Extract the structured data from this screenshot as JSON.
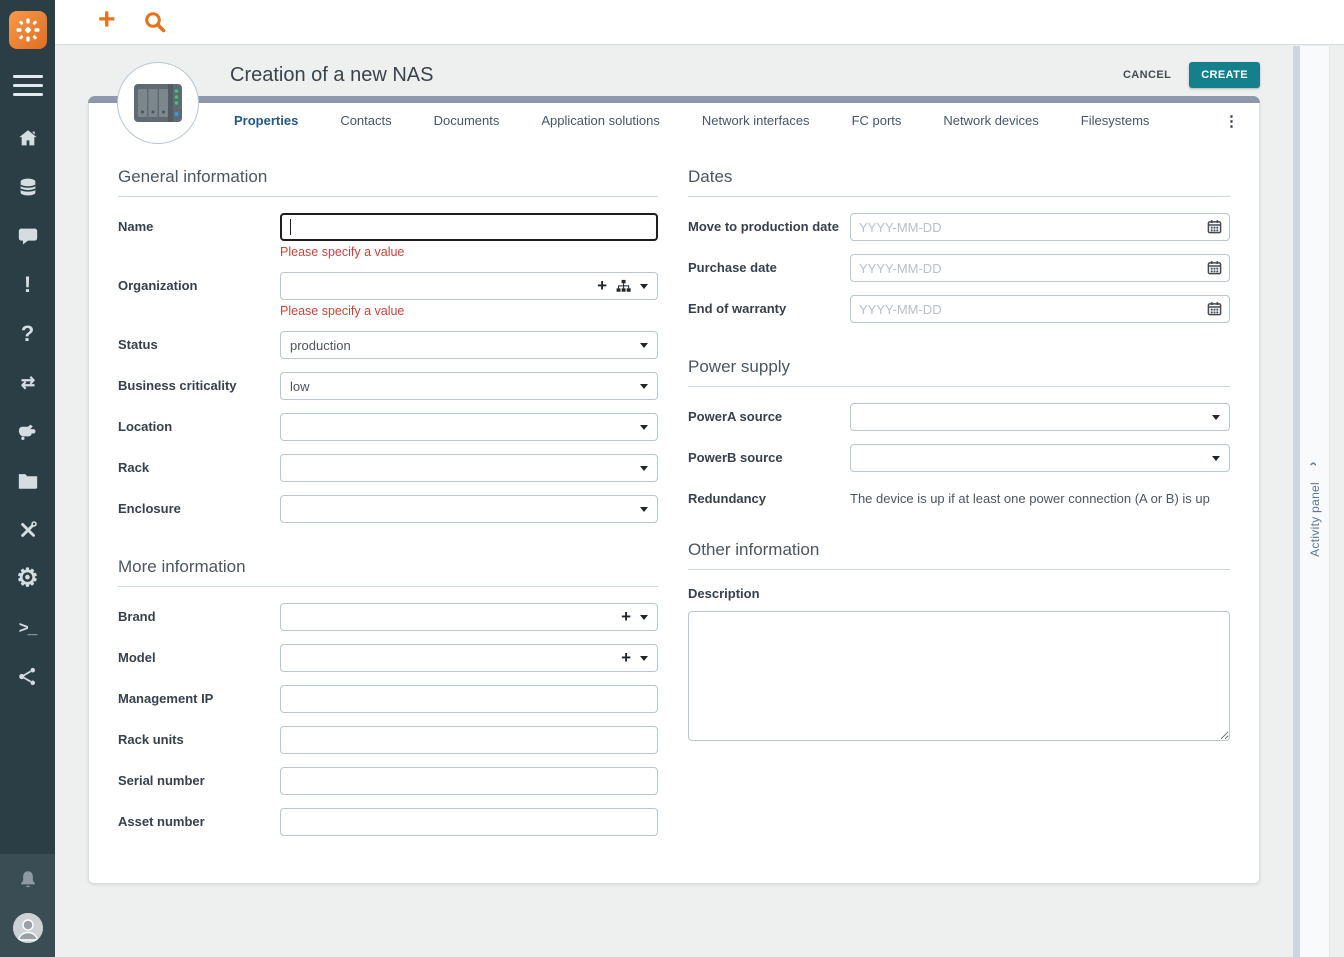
{
  "topbar": {
    "new_label": "+"
  },
  "sidebar": {
    "icons": [
      "itop-logo",
      "menu",
      "home",
      "database",
      "comment",
      "exclamation",
      "question",
      "transfer",
      "handshake",
      "folder",
      "tools",
      "gear",
      "terminal",
      "share"
    ],
    "footer_icons": [
      "bell",
      "user-avatar"
    ],
    "exclamation_glyph": "!",
    "question_glyph": "?",
    "transfer_glyph": "⇄",
    "gear_glyph": "⚙",
    "terminal_glyph": ">_"
  },
  "header": {
    "title": "Creation of a new NAS",
    "cancel": "CANCEL",
    "create": "CREATE"
  },
  "tabs": {
    "active": "Properties",
    "items": [
      "Properties",
      "Contacts",
      "Documents",
      "Application solutions",
      "Network interfaces",
      "FC ports",
      "Network devices",
      "Filesystems"
    ],
    "kebab_glyph": "⋮"
  },
  "form": {
    "general": {
      "title": "General information",
      "name": {
        "label": "Name",
        "value": "",
        "error": "Please specify a value"
      },
      "organization": {
        "label": "Organization",
        "value": "",
        "error": "Please specify a value"
      },
      "status": {
        "label": "Status",
        "value": "production"
      },
      "criticality": {
        "label": "Business criticality",
        "value": "low"
      },
      "location": {
        "label": "Location",
        "value": ""
      },
      "rack": {
        "label": "Rack",
        "value": ""
      },
      "enclosure": {
        "label": "Enclosure",
        "value": ""
      }
    },
    "more": {
      "title": "More information",
      "brand": {
        "label": "Brand",
        "value": ""
      },
      "model": {
        "label": "Model",
        "value": ""
      },
      "management_ip": {
        "label": "Management IP",
        "value": ""
      },
      "rack_units": {
        "label": "Rack units",
        "value": ""
      },
      "serial_number": {
        "label": "Serial number",
        "value": ""
      },
      "asset_number": {
        "label": "Asset number",
        "value": ""
      }
    },
    "dates": {
      "title": "Dates",
      "placeholder": "YYYY-MM-DD",
      "move_to_production": {
        "label": "Move to production date"
      },
      "purchase": {
        "label": "Purchase date"
      },
      "end_of_warranty": {
        "label": "End of warranty"
      }
    },
    "power": {
      "title": "Power supply",
      "power_a": {
        "label": "PowerA source",
        "value": ""
      },
      "power_b": {
        "label": "PowerB source",
        "value": ""
      },
      "redundancy": {
        "label": "Redundancy",
        "text": "The device is up if at least one power connection (A or B) is up"
      }
    },
    "other": {
      "title": "Other information",
      "description": {
        "label": "Description",
        "value": ""
      }
    }
  },
  "activity_panel": {
    "label": "Activity panel",
    "chevron_glyph": "‹"
  },
  "colors": {
    "accent": "#e4731c",
    "create_button": "#13808b",
    "error": "#c9453a",
    "tab_active": "#255787",
    "card_bar": "#8e9aab",
    "sidebar": "#2b3e46"
  }
}
